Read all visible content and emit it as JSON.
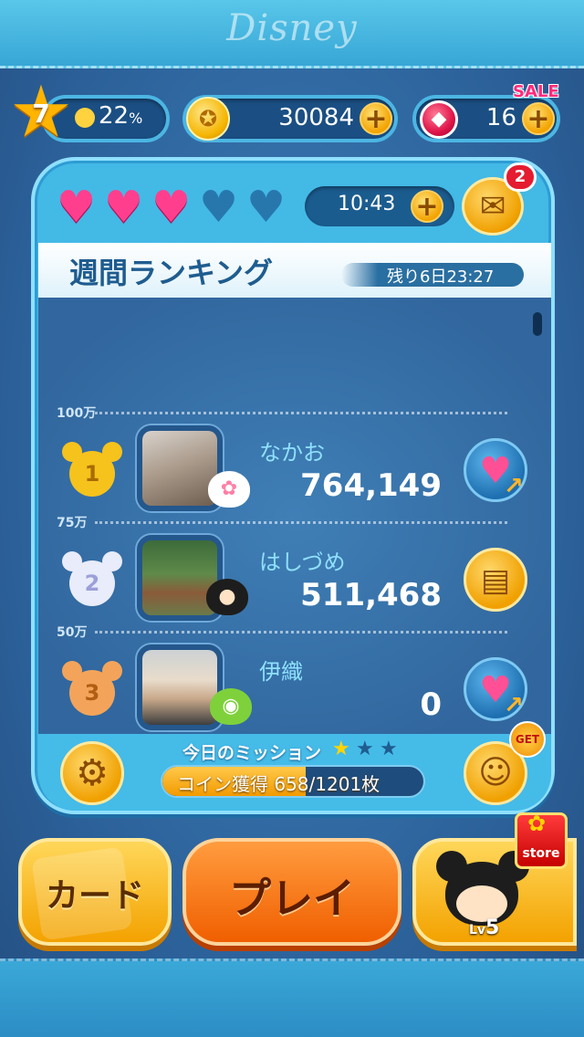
{
  "brand": "Disney",
  "status_bar": {
    "level": "7",
    "xp_percent": "22",
    "xp_unit": "%",
    "coins": "30084",
    "gems": "16",
    "sale_label": "SALE"
  },
  "hearts": {
    "filled": 3,
    "total": 5,
    "timer": "10:43"
  },
  "mail": {
    "badge_count": "2"
  },
  "ranking": {
    "title": "週間ランキング",
    "time_left": "残り6日23:27",
    "dividers": [
      "100万",
      "75万",
      "50万"
    ],
    "players": [
      {
        "rank": "1",
        "name": "なかお",
        "score": "764,149",
        "action": "send-heart"
      },
      {
        "rank": "2",
        "name": "はしづめ",
        "score": "511,468",
        "action": "view-profile"
      },
      {
        "rank": "3",
        "name": "伊織",
        "score": "0",
        "action": "send-heart"
      }
    ]
  },
  "mission": {
    "title": "今日のミッション",
    "stars_earned": 1,
    "stars_total": 3,
    "progress_text": "コイン獲得 658/1201枚",
    "progress_fraction": 0.548
  },
  "get_badge": "GET",
  "buttons": {
    "card": "カード",
    "play": "プレイ",
    "store": "store",
    "tsum_level_prefix": "Lv",
    "tsum_level": "5"
  },
  "colors": {
    "accent_blue": "#43b9e6",
    "gold": "#f3a200",
    "play_orange": "#f05f00",
    "heart_pink": "#ff3f8e"
  }
}
